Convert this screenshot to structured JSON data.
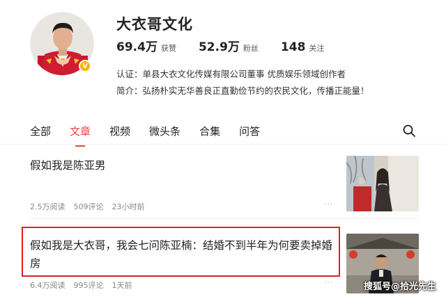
{
  "profile": {
    "name": "大衣哥文化",
    "stats": [
      {
        "value": "69.4万",
        "label": "获赞"
      },
      {
        "value": "52.9万",
        "label": "粉丝"
      },
      {
        "value": "148",
        "label": "关注"
      }
    ],
    "certification": "认证：单县大衣文化传媒有限公司董事 优质娱乐领域创作者",
    "bio": "简介：弘扬朴实无华善良正直勤俭节约的农民文化，传播正能量！",
    "verified_icon": "verified-badge-icon"
  },
  "tabs": [
    {
      "label": "全部",
      "active": false
    },
    {
      "label": "文章",
      "active": true
    },
    {
      "label": "视频",
      "active": false
    },
    {
      "label": "微头条",
      "active": false
    },
    {
      "label": "合集",
      "active": false
    },
    {
      "label": "问答",
      "active": false
    }
  ],
  "articles": [
    {
      "title": "假如我是陈亚男",
      "reads": "2.5万阅读",
      "comments": "509评论",
      "time": "23小时前",
      "more": "···"
    },
    {
      "title": "假如我是大衣哥，我会七问陈亚楠：结婚不到半年为何要卖掉婚房",
      "reads": "6.4万阅读",
      "comments": "995评论",
      "time": "1天前",
      "more": "···"
    }
  ],
  "watermark": "搜狐号@拾光先生",
  "colors": {
    "accent": "#f04142",
    "highlight_border": "#e02020",
    "badge": "#f5b400"
  }
}
